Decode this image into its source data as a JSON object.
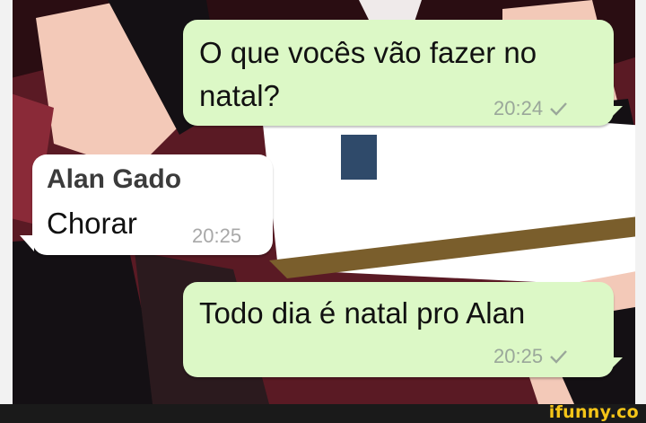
{
  "messages": [
    {
      "direction": "outgoing",
      "lines": [
        "O que vocês vão fazer no",
        "natal?"
      ],
      "time": "20:24",
      "status_icon": "check-sent-icon"
    },
    {
      "direction": "incoming",
      "sender": "Alan Gado",
      "lines": [
        "Chorar"
      ],
      "time": "20:25"
    },
    {
      "direction": "outgoing",
      "lines": [
        "Todo dia é natal pro Alan"
      ],
      "time": "20:25",
      "status_icon": "check-sent-icon"
    }
  ],
  "watermark": "ifunny.co",
  "colors": {
    "outgoing_bubble": "#dcf8c6",
    "incoming_bubble": "#ffffff",
    "watermark": "#f5c518"
  }
}
